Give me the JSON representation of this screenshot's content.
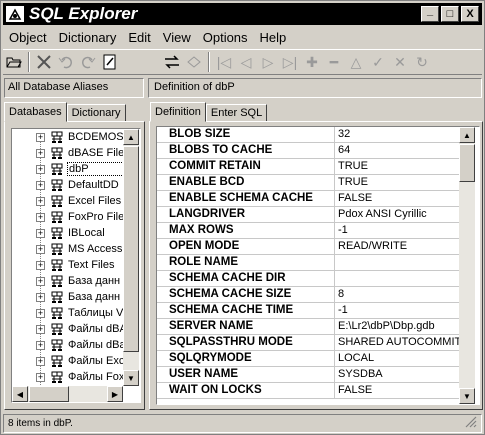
{
  "window": {
    "title": "SQL Explorer"
  },
  "caption": {
    "minimize": "_",
    "maximize": "□",
    "close": "X"
  },
  "menu": [
    {
      "label": "Object"
    },
    {
      "label": "Dictionary"
    },
    {
      "label": "Edit"
    },
    {
      "label": "View"
    },
    {
      "label": "Options"
    },
    {
      "label": "Help"
    }
  ],
  "header": {
    "left": "All Database Aliases",
    "right": "Definition of dbP"
  },
  "left_tabs": [
    {
      "label": "Databases"
    },
    {
      "label": "Dictionary"
    }
  ],
  "right_tabs": [
    {
      "label": "Definition"
    },
    {
      "label": "Enter SQL"
    }
  ],
  "tree": [
    {
      "label": "BCDEMOS",
      "icon": "database-icon"
    },
    {
      "label": "dBASE Files",
      "icon": "database-icon"
    },
    {
      "label": "dbP",
      "icon": "database-icon"
    },
    {
      "label": "DefaultDD",
      "icon": "database-icon"
    },
    {
      "label": "Excel Files",
      "icon": "database-icon"
    },
    {
      "label": "FoxPro Files",
      "icon": "database-icon"
    },
    {
      "label": "IBLocal",
      "icon": "database-icon"
    },
    {
      "label": "MS Access",
      "icon": "database-icon"
    },
    {
      "label": "Text Files",
      "icon": "database-icon"
    },
    {
      "label": "База данн",
      "icon": "database-icon"
    },
    {
      "label": "База данн",
      "icon": "database-icon"
    },
    {
      "label": "Таблицы V",
      "icon": "database-icon"
    },
    {
      "label": "Файлы dBA",
      "icon": "database-icon"
    },
    {
      "label": "Файлы dBa",
      "icon": "database-icon"
    },
    {
      "label": "Файлы Exc",
      "icon": "database-icon"
    },
    {
      "label": "Файлы Fox",
      "icon": "database-icon"
    }
  ],
  "properties": [
    {
      "name": "BLOB SIZE",
      "value": "32"
    },
    {
      "name": "BLOBS TO CACHE",
      "value": "64"
    },
    {
      "name": "COMMIT RETAIN",
      "value": "TRUE"
    },
    {
      "name": "ENABLE BCD",
      "value": "TRUE"
    },
    {
      "name": "ENABLE SCHEMA CACHE",
      "value": "FALSE"
    },
    {
      "name": "LANGDRIVER",
      "value": "Pdox ANSI Cyrillic"
    },
    {
      "name": "MAX ROWS",
      "value": "-1"
    },
    {
      "name": "OPEN MODE",
      "value": "READ/WRITE"
    },
    {
      "name": "ROLE NAME",
      "value": ""
    },
    {
      "name": "SCHEMA CACHE DIR",
      "value": ""
    },
    {
      "name": "SCHEMA CACHE SIZE",
      "value": "8"
    },
    {
      "name": "SCHEMA CACHE TIME",
      "value": "-1"
    },
    {
      "name": "SERVER NAME",
      "value": "E:\\Lr2\\dbP\\Dbp.gdb"
    },
    {
      "name": "SQLPASSTHRU MODE",
      "value": "SHARED AUTOCOMMIT"
    },
    {
      "name": "SQLQRYMODE",
      "value": "LOCAL"
    },
    {
      "name": "USER NAME",
      "value": "SYSDBA"
    },
    {
      "name": "WAIT ON LOCKS",
      "value": "FALSE"
    }
  ],
  "status": {
    "text": "8 items in dbP."
  }
}
